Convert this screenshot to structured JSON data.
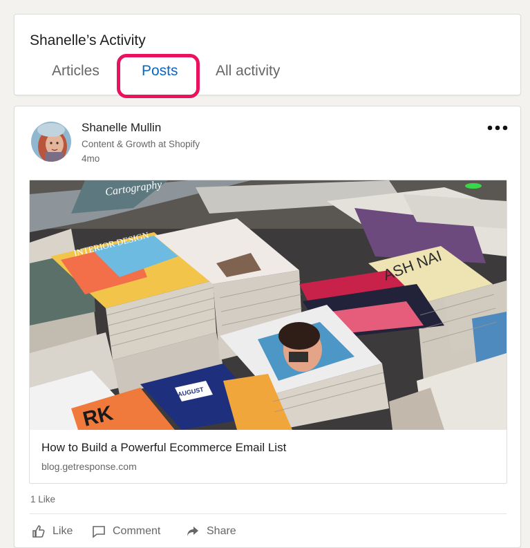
{
  "activity": {
    "title": "Shanelle’s Activity",
    "tabs": {
      "articles": "Articles",
      "posts": "Posts",
      "all_activity": "All activity"
    },
    "selected_tab": "Posts"
  },
  "post": {
    "author_name": "Shanelle Mullin",
    "author_headline": "Content & Growth at Shopify",
    "age": "4mo",
    "more_icon": "more-horizontal-icon",
    "article": {
      "title": "How to Build a Powerful Ecommerce Email List",
      "source": "blog.getresponse.com",
      "image_labels": {
        "cartography": "Cartography",
        "interior_design": "INTERIOR DESIGN",
        "ash_nai": "ASH NAI",
        "august": "AUGUST",
        "ark": "RK"
      }
    },
    "likes_text": "1 Like",
    "actions": {
      "like": "Like",
      "comment": "Comment",
      "share": "Share"
    }
  },
  "colors": {
    "accent": "#0a66c2",
    "highlight": "#e8125f",
    "background": "#f3f2ef"
  }
}
